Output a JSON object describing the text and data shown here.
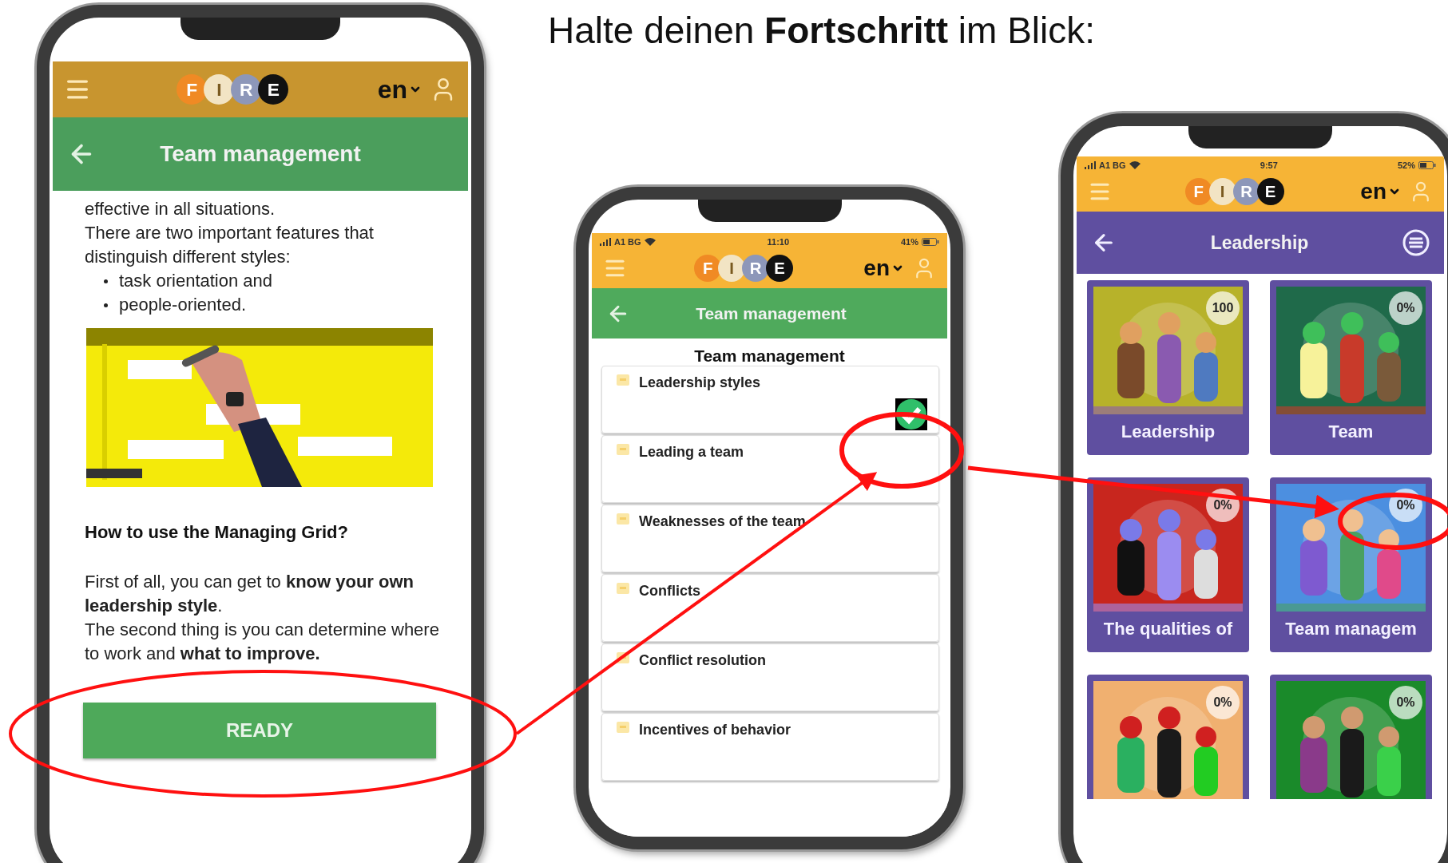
{
  "title": "Halte deinen **Fortschritt** im Blick:",
  "phones": [
    {
      "kind": "lesson",
      "logo": [
        "F",
        "I",
        "R",
        "E"
      ],
      "language": "en",
      "title": "Team management",
      "intro": [
        "effective in all situations.",
        "There are two important features that distinguish different styles:"
      ],
      "bullets": [
        "task orientation and",
        "people-oriented."
      ],
      "heading": "How to use the Managing Grid?",
      "paragraphs": [
        "First of all, you can get to **know your own leadership style**.",
        "The second thing is you can determine where to work and **what to improve.**"
      ],
      "button": "READY"
    },
    {
      "kind": "topics",
      "status": {
        "carrier": "A1 BG",
        "time": "11:10",
        "battery": "41%"
      },
      "logo": [
        "F",
        "I",
        "R",
        "E"
      ],
      "language": "en",
      "title": "Team management",
      "heading": "Team management",
      "items": [
        {
          "label": "Leadership styles",
          "completed": true
        },
        {
          "label": "Leading a team",
          "completed": false
        },
        {
          "label": "Weaknesses of the team",
          "completed": false
        },
        {
          "label": "Conflicts",
          "completed": false
        },
        {
          "label": "Conflict resolution",
          "completed": false
        },
        {
          "label": "Incentives of behavior",
          "completed": false
        }
      ]
    },
    {
      "kind": "modules",
      "status": {
        "carrier": "A1 BG",
        "time": "9:57",
        "battery": "52%"
      },
      "logo": [
        "F",
        "I",
        "R",
        "E"
      ],
      "language": "en",
      "title": "Leadership",
      "cards": [
        {
          "title": "Leadership",
          "progress": "100"
        },
        {
          "title": "Team",
          "progress": "0%"
        },
        {
          "title": "The qualities of",
          "progress": "0%"
        },
        {
          "title": "Team managem",
          "progress": "0%"
        },
        {
          "progress": "0%"
        },
        {
          "progress": "0%"
        }
      ]
    }
  ]
}
